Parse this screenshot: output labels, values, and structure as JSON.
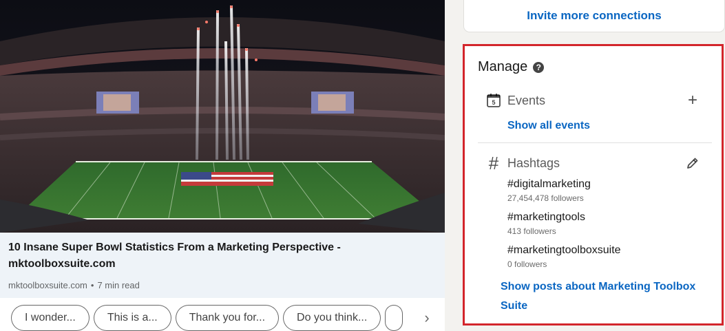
{
  "post": {
    "article_title": "10 Insane Super Bowl Statistics From a Marketing Perspective - mktoolboxsuite.com",
    "source": "mktoolboxsuite.com",
    "separator": "•",
    "read_time": "7 min read",
    "suggested_replies": [
      "I wonder...",
      "This is a...",
      "Thank you for...",
      "Do you think..."
    ],
    "next_icon": "chevron-right-icon",
    "next_glyph": "›"
  },
  "invite": {
    "label": "Invite more connections"
  },
  "manage": {
    "title": "Manage",
    "help_glyph": "?",
    "events": {
      "label": "Events",
      "calendar_day": "5",
      "add_glyph": "+",
      "show_all": "Show all events"
    },
    "hashtags": {
      "label": "Hashtags",
      "hash_glyph": "#",
      "items": [
        {
          "name": "#digitalmarketing",
          "followers": "27,454,478 followers"
        },
        {
          "name": "#marketingtools",
          "followers": "413 followers"
        },
        {
          "name": "#marketingtoolboxsuite",
          "followers": "0 followers"
        }
      ],
      "show_posts": "Show posts about Marketing Toolbox Suite"
    }
  },
  "colors": {
    "link_blue": "#0a66c2",
    "highlight_red": "#d3252b",
    "page_bg": "#f3f2ef",
    "article_bg": "#eef3f8"
  }
}
